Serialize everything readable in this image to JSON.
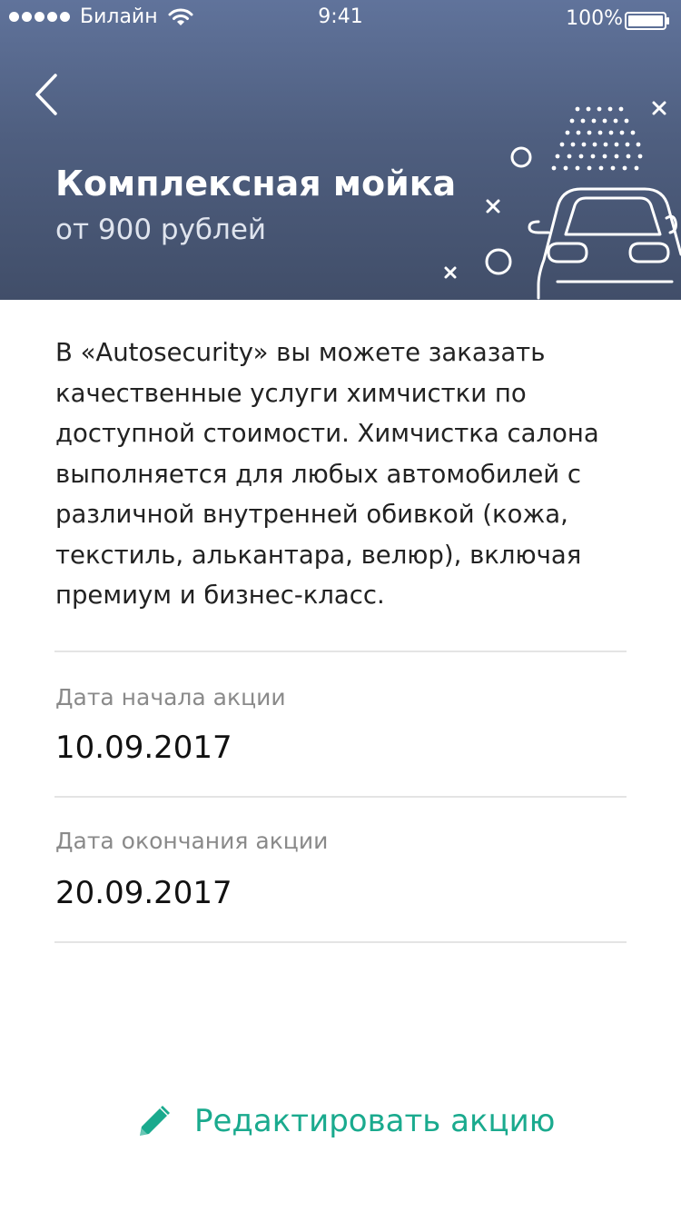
{
  "status_bar": {
    "carrier": "Билайн",
    "time": "9:41",
    "battery": "100%"
  },
  "header": {
    "title": "Комплексная мойка",
    "subtitle": "от 900 рублей",
    "back_icon": "chevron-left-icon",
    "illustration_icon": "car-wash-icon"
  },
  "content": {
    "description": "В «Autosecurity» вы можете заказать качественные услуги химчистки по доступной стоимости. Химчистка салона выполняется для любых автомобилей с различной внутренней обивкой (кожа, текстиль, алькантара, велюр), включая премиум и бизнес-класс.",
    "start_label": "Дата начала акции",
    "start_value": "10.09.2017",
    "end_label": "Дата окончания акции",
    "end_value": "20.09.2017"
  },
  "actions": {
    "edit_label": "Редактировать акцию",
    "edit_icon": "pencil-icon"
  },
  "colors": {
    "header_top": "#60739b",
    "header_bottom": "#414e69",
    "accent": "#1aaa8e"
  }
}
